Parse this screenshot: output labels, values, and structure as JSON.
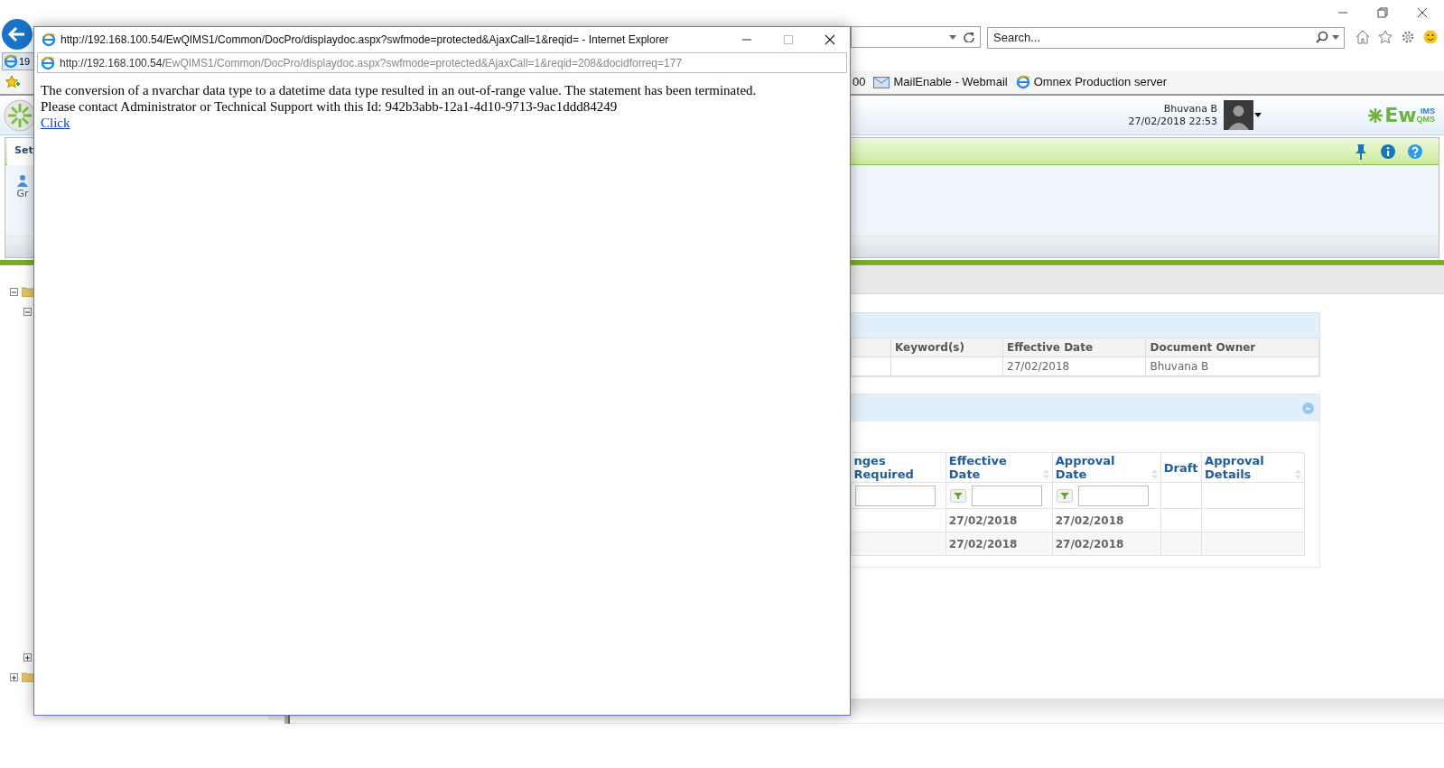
{
  "browser": {
    "tab": {
      "label": "19",
      "selected": true
    },
    "search": {
      "placeholder": "Search..."
    },
    "favorites": [
      {
        "label": "00",
        "kind": "text"
      },
      {
        "label": "MailEnable - Webmail",
        "kind": "mail"
      },
      {
        "label": "Omnex Production server",
        "kind": "page"
      }
    ]
  },
  "app": {
    "user": {
      "name": "Bhuvana B",
      "datetime": "27/02/2018 22:53"
    },
    "logo": {
      "main": "Ew",
      "top": "IMS",
      "bottom": "QMS"
    },
    "ribbon": {
      "tab": "Set",
      "item": "Gr"
    },
    "tree": [
      {
        "expanded": true,
        "children": [
          {
            "expanded": true
          },
          {
            "expanded": false
          }
        ]
      },
      {
        "expanded": false
      }
    ],
    "document_table": {
      "columns": [
        "Keyword(s)",
        "Effective Date",
        "Document Owner"
      ],
      "rows": [
        {
          "effective_date": "27/02/2018",
          "document_owner": "Bhuvana B"
        }
      ]
    },
    "revision_grid": {
      "expanded": true,
      "columns": [
        {
          "label": "nges Required",
          "sortable": false,
          "kind": "text"
        },
        {
          "label": "Effective Date",
          "sortable": true,
          "kind": "date"
        },
        {
          "label": "Approval Date",
          "sortable": true,
          "kind": "date"
        },
        {
          "label": "Draft",
          "sortable": false,
          "kind": "plain"
        },
        {
          "label": "Approval Details",
          "sortable": true,
          "kind": "plain"
        }
      ],
      "rows": [
        {
          "effective_date": "27/02/2018",
          "approval_date": "27/02/2018"
        },
        {
          "effective_date": "27/02/2018",
          "approval_date": "27/02/2018"
        }
      ]
    }
  },
  "popup": {
    "title": "http://192.168.100.54/EwQIMS1/Common/DocPro/displaydoc.aspx?swfmode=protected&AjaxCall=1&reqid= - Internet Explorer",
    "address_host": "http://192.168.100.54/",
    "address_path": "EwQIMS1/Common/DocPro/displaydoc.aspx?swfmode=protected&AjaxCall=1&reqid=208&docidforreq=177",
    "message": [
      "The conversion of a nvarchar data type to a datetime data type resulted in an out-of-range value. The statement has been terminated.",
      "Please contact Administrator or Technical Support with this Id: 942b3abb-12a1-4d10-9713-9ac1ddd84249"
    ],
    "link": "Click"
  }
}
